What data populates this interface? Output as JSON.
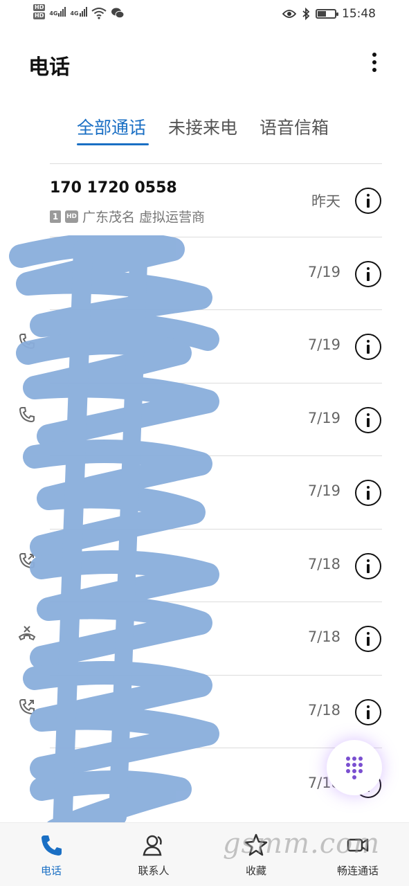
{
  "status_bar": {
    "hd1": "HD",
    "hd2": "HD",
    "net1": "4G",
    "net2": "4G",
    "time": "15:48",
    "icons": [
      "eye-icon",
      "bluetooth-icon",
      "battery-icon",
      "wifi-icon",
      "wechat-icon"
    ]
  },
  "header": {
    "title": "电话"
  },
  "tabs": [
    {
      "label": "全部通话",
      "active": true
    },
    {
      "label": "未接来电",
      "active": false
    },
    {
      "label": "语音信箱",
      "active": false
    }
  ],
  "calls": [
    {
      "name": "170 1720 0558",
      "sim": "1",
      "hd": "HD",
      "location": "广东茂名 虚拟运营商",
      "date": "昨天"
    },
    {
      "name": "",
      "sim": "",
      "hd": "",
      "location": "",
      "date": "7/19"
    },
    {
      "name": "",
      "sim": "",
      "hd": "",
      "location": "",
      "date": "7/19"
    },
    {
      "name": "",
      "sim": "",
      "hd": "",
      "location": "",
      "date": "7/19"
    },
    {
      "name": "",
      "sim": "",
      "hd": "",
      "location": "",
      "date": "7/19"
    },
    {
      "name": "",
      "sim": "",
      "hd": "",
      "location": "",
      "date": "7/18"
    },
    {
      "name": "",
      "sim": "",
      "hd": "",
      "location": "",
      "date": "7/18"
    },
    {
      "name": "",
      "sim": "",
      "hd": "",
      "location": "",
      "date": "7/18"
    },
    {
      "name": "",
      "sim": "",
      "hd": "",
      "location": "",
      "date": "7/18"
    }
  ],
  "bottom_nav": [
    {
      "label": "电话",
      "icon": "phone-icon",
      "active": true
    },
    {
      "label": "联系人",
      "icon": "contacts-icon",
      "active": false
    },
    {
      "label": "收藏",
      "icon": "star-icon",
      "active": false
    },
    {
      "label": "畅连通话",
      "icon": "video-call-icon",
      "active": false
    }
  ],
  "watermark": "gsmm.com",
  "colors": {
    "accent": "#1a6fc4",
    "scribble": "#8aaedc",
    "fab_dots": "#7a4fd0"
  }
}
